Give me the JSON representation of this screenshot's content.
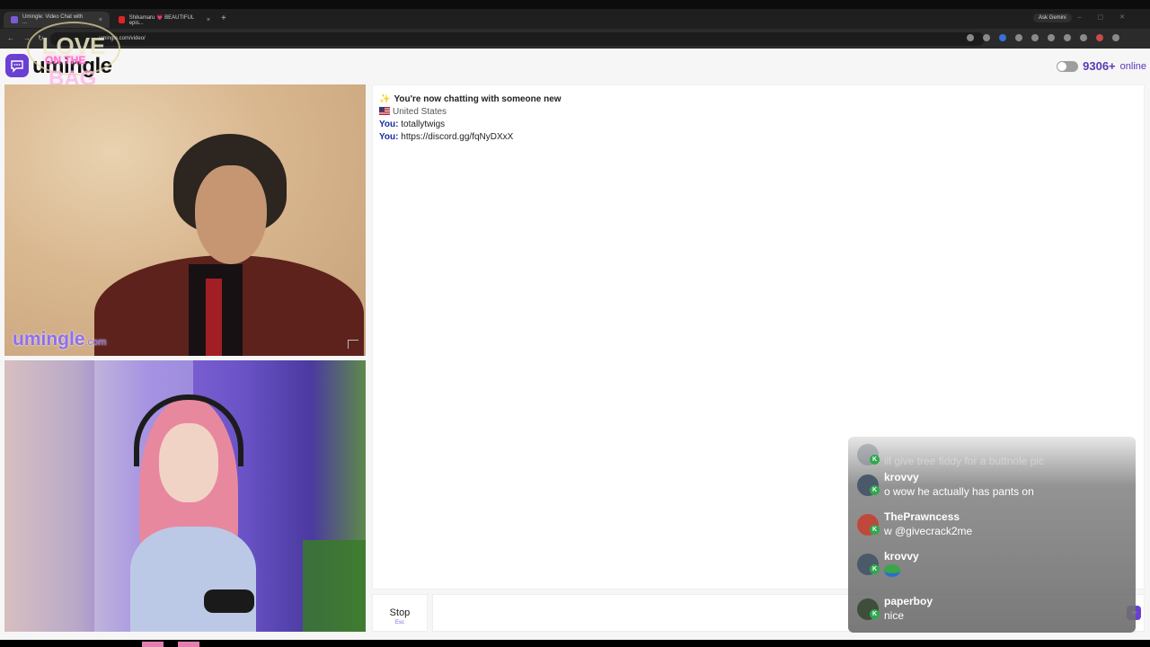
{
  "browser": {
    "tabs": [
      {
        "title": "Umingle: Video Chat with ...",
        "color": "#7b5ad8"
      },
      {
        "title": "Shikamaru 💗 BEAUTIFUL epis...",
        "color": "#e02424"
      }
    ],
    "new_tab": "+",
    "ask_gemini": "Ask Gemini",
    "url": "umingle.com/video/"
  },
  "header": {
    "logo": "umingle",
    "online_count": "9306+",
    "online_label": "online"
  },
  "stream_overlay": {
    "love": "LOVE",
    "on_the": "ON THE",
    "bag": "BAG"
  },
  "video": {
    "watermark": "umingle",
    "watermark_suffix": ".com"
  },
  "chat": {
    "system_message": "You're now chatting with someone new",
    "country": "United States",
    "messages": [
      {
        "sender": "You:",
        "text": "totallytwigs"
      },
      {
        "sender": "You:",
        "text": "https://discord.gg/fqNyDXxX"
      }
    ]
  },
  "controls": {
    "stop_label": "Stop",
    "stop_hint": "Esc",
    "send_icon": "send-icon"
  },
  "stream_chat": [
    {
      "user": "",
      "text": "ill give tree fiddy for a buttnole pic"
    },
    {
      "user": "krovvy",
      "text": "o wow he actually has pants on"
    },
    {
      "user": "ThePrawncess",
      "text": "w @givecrack2me"
    },
    {
      "user": "krovvy",
      "text": ""
    },
    {
      "user": "paperboy",
      "text": "nice"
    }
  ],
  "colors": {
    "brand": "#6a3fd3",
    "online": "#5a38b8",
    "you_label": "#1c2a9e"
  }
}
